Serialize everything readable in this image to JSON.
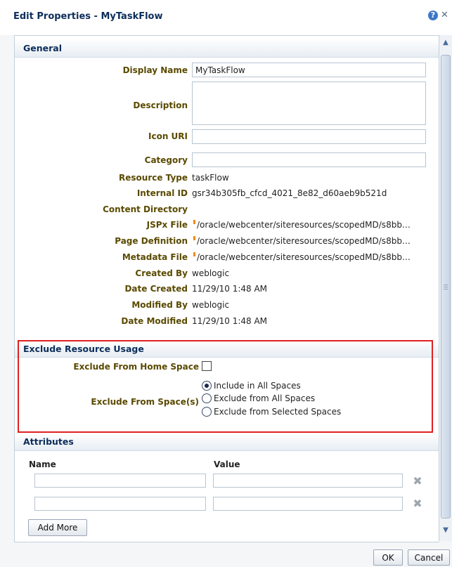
{
  "dialog": {
    "title": "Edit Properties - MyTaskFlow",
    "help_icon": "help-icon",
    "close_icon": "close-icon"
  },
  "general": {
    "section_title": "General",
    "display_name_label": "Display Name",
    "display_name_value": "MyTaskFlow",
    "description_label": "Description",
    "description_value": "",
    "icon_uri_label": "Icon URI",
    "icon_uri_value": "",
    "category_label": "Category",
    "category_value": "",
    "resource_type_label": "Resource Type",
    "resource_type_value": "taskFlow",
    "internal_id_label": "Internal ID",
    "internal_id_value": "gsr34b305fb_cfcd_4021_8e82_d60aeb9b521d",
    "content_directory_label": "Content Directory",
    "jspx_file_label": "JSPx File",
    "jspx_file_value": "/oracle/webcenter/siteresources/scopedMD/s8bb…",
    "page_definition_label": "Page Definition",
    "page_definition_value": "/oracle/webcenter/siteresources/scopedMD/s8bb…",
    "metadata_file_label": "Metadata File",
    "metadata_file_value": "/oracle/webcenter/siteresources/scopedMD/s8bb…",
    "created_by_label": "Created By",
    "created_by_value": "weblogic",
    "date_created_label": "Date Created",
    "date_created_value": "11/29/10 1:48 AM",
    "modified_by_label": "Modified By",
    "modified_by_value": "weblogic",
    "date_modified_label": "Date Modified",
    "date_modified_value": "11/29/10 1:48 AM"
  },
  "exclude": {
    "section_title": "Exclude Resource Usage",
    "home_space_label": "Exclude From Home Space",
    "home_space_checked": false,
    "spaces_label": "Exclude From Space(s)",
    "options": [
      "Include in All Spaces",
      "Exclude from All Spaces",
      "Exclude from Selected Spaces"
    ],
    "selected_option": "Include in All Spaces"
  },
  "attributes": {
    "section_title": "Attributes",
    "name_header": "Name",
    "value_header": "Value",
    "rows": [
      {
        "name": "",
        "value": ""
      },
      {
        "name": "",
        "value": ""
      }
    ],
    "add_more_label": "Add More"
  },
  "footer": {
    "ok_label": "OK",
    "cancel_label": "Cancel"
  },
  "colors": {
    "accent_title": "#0c2d5a",
    "label_brown": "#5a4a00",
    "highlight_border": "#e02020",
    "file_marker": "#f08a1a"
  }
}
